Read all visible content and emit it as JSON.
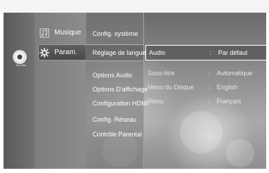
{
  "left_panel": {
    "disc_label": "No Disc"
  },
  "main_menu": {
    "items": [
      {
        "label": "Musique",
        "icon": "music-icon"
      },
      {
        "label": "Param.",
        "icon": "gear-icon"
      }
    ],
    "selected_index": 1
  },
  "sub_menu": {
    "items": [
      "Config. système",
      "Réglage de langue",
      "Options Audio",
      "Options D'affichage",
      "Configuration HDMI",
      "Config. Réseau",
      "Contrôle Parental"
    ],
    "selected_index": 1
  },
  "detail": {
    "rows": [
      {
        "label": "Audio",
        "value": "Par défaut"
      },
      {
        "label": "Sous-titre",
        "value": "Automatique"
      },
      {
        "label": "Menu du Disque",
        "value": "English"
      },
      {
        "label": "Menu",
        "value": "Français"
      }
    ],
    "selected_index": 0
  },
  "colors": {
    "highlight_border": "#ffffff",
    "background": "#8a8a8a"
  }
}
